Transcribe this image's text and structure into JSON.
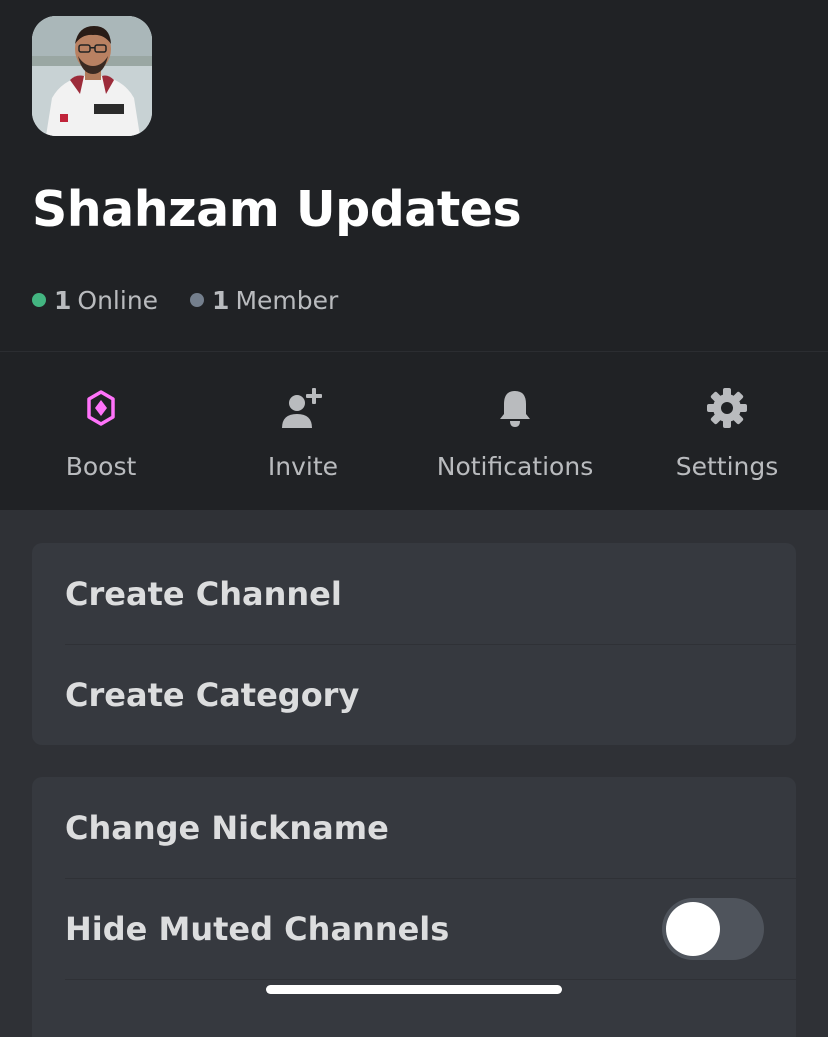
{
  "server": {
    "name": "Shahzam Updates",
    "avatar_icon": "server-avatar-photo",
    "online_count": "1",
    "online_label": "Online",
    "member_count": "1",
    "member_label": "Member"
  },
  "actions": [
    {
      "label": "Boost",
      "icon": "boost-gem-icon"
    },
    {
      "label": "Invite",
      "icon": "add-person-icon"
    },
    {
      "label": "Notifications",
      "icon": "bell-icon"
    },
    {
      "label": "Settings",
      "icon": "gear-icon"
    }
  ],
  "menu_group_1": [
    {
      "label": "Create Channel"
    },
    {
      "label": "Create Category"
    }
  ],
  "menu_group_2": [
    {
      "label": "Change Nickname"
    },
    {
      "label": "Hide Muted Channels",
      "toggle_on": false
    }
  ],
  "colors": {
    "online": "#43b581",
    "offline": "#747f8d",
    "boost": "#ff73fa",
    "header_bg": "#202225",
    "body_bg": "#2f3136",
    "card_bg": "#36393f"
  }
}
